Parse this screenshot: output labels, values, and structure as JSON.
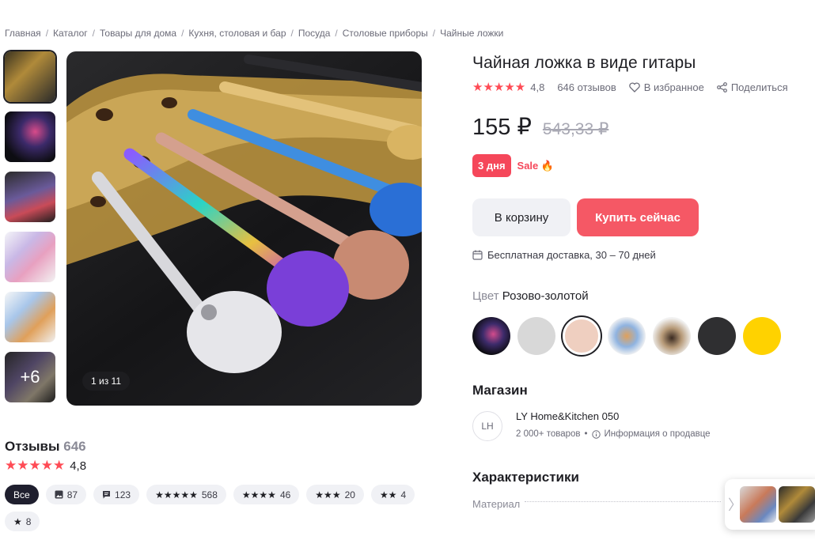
{
  "breadcrumb": [
    "Главная",
    "Каталог",
    "Товары для дома",
    "Кухня, столовая и бар",
    "Посуда",
    "Столовые приборы",
    "Чайные ложки"
  ],
  "gallery": {
    "thumbnails": [
      "thumb-1",
      "thumb-2",
      "thumb-3",
      "thumb-4",
      "thumb-5",
      "thumb-6"
    ],
    "more_label": "+6",
    "counter": "1 из 11"
  },
  "product": {
    "title": "Чайная ложка в виде гитары",
    "stars": "★★★★★",
    "rating": "4,8",
    "reviews_link": "646 отзывов",
    "favorite_label": "В избранное",
    "share_label": "Поделиться",
    "price": "155 ₽",
    "old_price": "543,33 ₽",
    "badge_days": "3 дня",
    "badge_sale": "Sale 🔥",
    "cart_button": "В корзину",
    "buy_button": "Купить сейчас",
    "delivery": "Бесплатная доставка, 30 – 70 дней"
  },
  "color": {
    "label_key": "Цвет",
    "selected": "Розово-золотой",
    "options": [
      "multicolor-dark",
      "silver",
      "rose-gold",
      "mix-blue",
      "mix-coffee",
      "black",
      "gold"
    ]
  },
  "shop": {
    "heading": "Магазин",
    "logo_text": "LH",
    "name": "LY Home&Kitchen 050",
    "items_count": "2 000+ товаров",
    "dot": "•",
    "seller_info": "Информация о продавце"
  },
  "characteristics": {
    "heading": "Характеристики",
    "rows": [
      {
        "label": "Материал"
      }
    ]
  },
  "reviews": {
    "heading": "Отзывы",
    "count": "646",
    "stars": "★★★★★",
    "rating": "4,8",
    "filters": [
      {
        "label": "Все",
        "active": true
      },
      {
        "icon": "photo-icon",
        "label": "87"
      },
      {
        "icon": "comment-icon",
        "label": "123"
      },
      {
        "stars": "★★★★★",
        "label": "568"
      },
      {
        "stars": "★★★★",
        "label": "46"
      },
      {
        "stars": "★★★",
        "label": "20"
      },
      {
        "stars": "★★",
        "label": "4"
      },
      {
        "stars": "★",
        "label": "8"
      }
    ]
  },
  "colors": {
    "accent": "#f55865",
    "star": "#ff4b55",
    "chip_active": "#1f1f2e"
  }
}
